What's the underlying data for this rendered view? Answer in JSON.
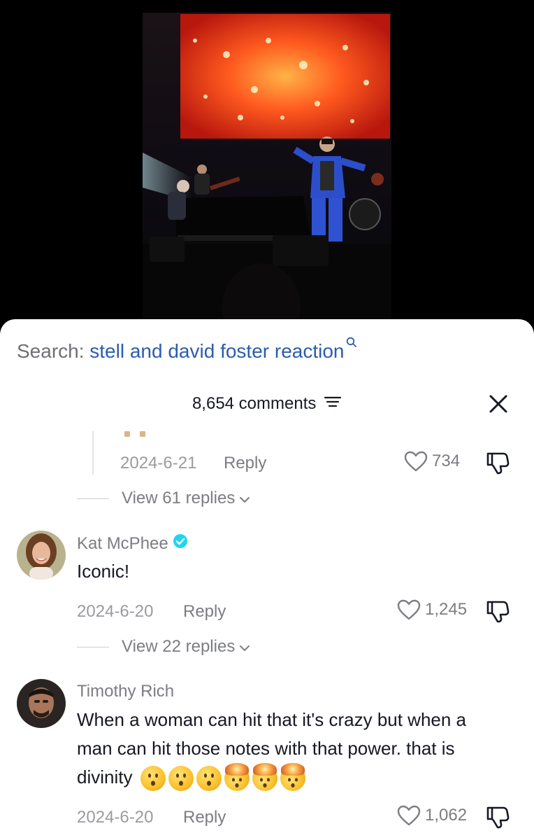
{
  "search": {
    "prefix": "Search:",
    "term": "stell and david foster reaction"
  },
  "header": {
    "comments_count": "8,654 comments"
  },
  "previous_comment": {
    "date": "2024-6-21",
    "reply_label": "Reply",
    "likes": "734",
    "view_replies": "View 61 replies"
  },
  "comments": [
    {
      "username": "Kat McPhee",
      "verified": true,
      "text": "Iconic!",
      "date": "2024-6-20",
      "reply_label": "Reply",
      "likes": "1,245",
      "view_replies": "View 22 replies"
    },
    {
      "username": "Timothy Rich",
      "verified": false,
      "text": "When a woman can hit that it's crazy but when a man can hit those notes with that power. that is divinity",
      "emojis": [
        "hushed-face",
        "hushed-face",
        "hushed-face",
        "exploding-head",
        "exploding-head",
        "exploding-head"
      ],
      "date": "2024-6-20",
      "reply_label": "Reply",
      "likes": "1,062"
    }
  ],
  "colors": {
    "search_term": "#2b5cae",
    "verified": "#20d5ec",
    "muted_text": "#7c7d82"
  }
}
